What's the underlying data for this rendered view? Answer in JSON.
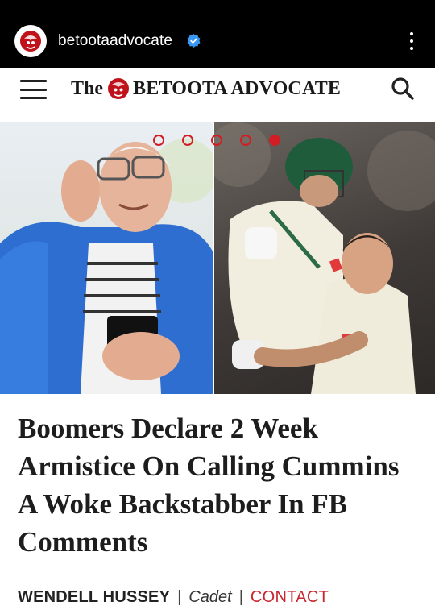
{
  "instagram": {
    "account_name": "betootaadvocate",
    "verified": true,
    "more_icon": "vertical-ellipsis-icon"
  },
  "site_header": {
    "menu_icon": "hamburger-menu-icon",
    "logo_prefix": "The",
    "logo_name": "BETOOTA ADVOCATE",
    "search_icon": "search-icon",
    "brand_color": "#c0121b"
  },
  "carousel": {
    "slide_count": 5,
    "active_index": 4
  },
  "article": {
    "headline": "Boomers Declare 2 Week Armistice On Calling Cummins A Woke Backstabber In FB Comments",
    "author": "WENDELL HUSSEY",
    "separator": "|",
    "role": "Cadet",
    "contact_label": "CONTACT",
    "contact_color": "#c7262e"
  }
}
